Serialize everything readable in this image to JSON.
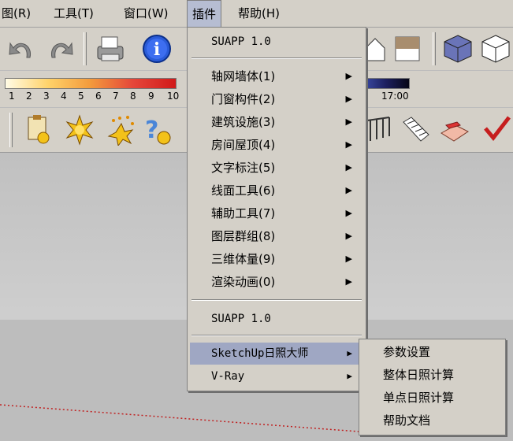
{
  "menubar": {
    "items": [
      {
        "label": "图(R)"
      },
      {
        "label": "工具(T)"
      },
      {
        "label": "窗口(W)"
      },
      {
        "label": "插件"
      },
      {
        "label": "帮助(H)"
      }
    ]
  },
  "shadow_toolbar": {
    "ticks": [
      "1",
      "2",
      "3",
      "4",
      "5",
      "6",
      "7",
      "8",
      "9",
      "10"
    ],
    "time_label": "17:00"
  },
  "plugin_menu": {
    "header": "SUAPP 1.0",
    "items": [
      {
        "label": "轴网墙体(1)"
      },
      {
        "label": "门窗构件(2)"
      },
      {
        "label": "建筑设施(3)"
      },
      {
        "label": "房间屋顶(4)"
      },
      {
        "label": "文字标注(5)"
      },
      {
        "label": "线面工具(6)"
      },
      {
        "label": "辅助工具(7)"
      },
      {
        "label": "图层群组(8)"
      },
      {
        "label": "三维体量(9)"
      },
      {
        "label": "渲染动画(0)"
      }
    ],
    "footer_item": "SUAPP 1.0",
    "sunlight_item": "SketchUp日照大师",
    "vray_item": "V-Ray",
    "arrow_glyph": "▶"
  },
  "sunlight_submenu": {
    "items": [
      {
        "label": "参数设置"
      },
      {
        "label": "整体日照计算"
      },
      {
        "label": "单点日照计算"
      },
      {
        "label": "帮助文档"
      }
    ]
  },
  "colors": {
    "menu_bg": "#d4d0c8",
    "highlight": "#9fa7c3",
    "active_menu": "#b6bdd2"
  }
}
